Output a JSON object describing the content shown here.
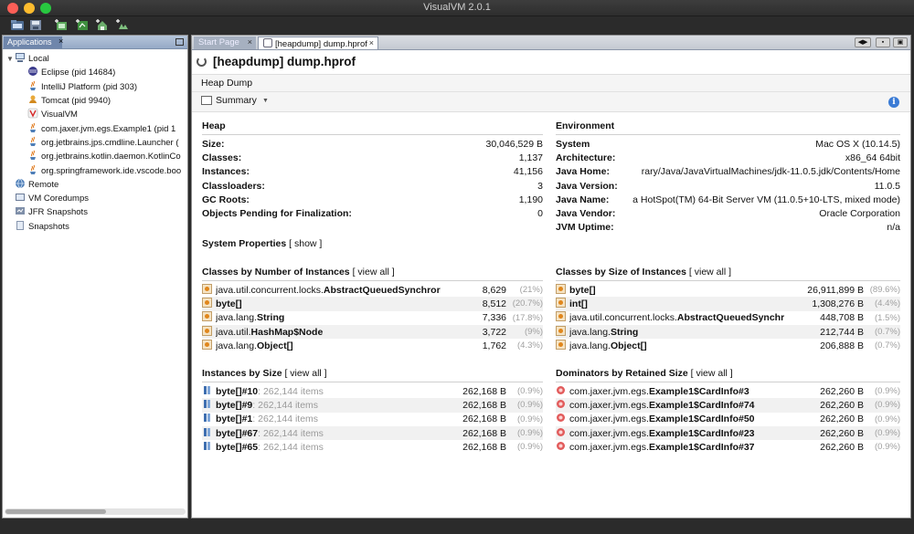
{
  "window": {
    "title": "VisualVM 2.0.1"
  },
  "toolbar": {
    "buttons": [
      "open-icon",
      "save-icon",
      "add-jmx-icon",
      "add-heap-icon",
      "add-host-icon",
      "add-snapshot-icon"
    ]
  },
  "left_panel": {
    "tab_label": "Applications",
    "tab_close": "×",
    "tree": [
      {
        "label": "Local",
        "level": 0,
        "icon": "computer-icon"
      },
      {
        "label": "Eclipse (pid 14684)",
        "level": 1,
        "icon": "eclipse-icon"
      },
      {
        "label": "IntelliJ Platform (pid 303)",
        "level": 1,
        "icon": "java-icon"
      },
      {
        "label": "Tomcat (pid 9940)",
        "level": 1,
        "icon": "tomcat-icon"
      },
      {
        "label": "VisualVM",
        "level": 1,
        "icon": "visualvm-icon"
      },
      {
        "label": "com.jaxer.jvm.egs.Example1 (pid 1",
        "level": 1,
        "icon": "java-icon"
      },
      {
        "label": "org.jetbrains.jps.cmdline.Launcher (",
        "level": 1,
        "icon": "java-icon"
      },
      {
        "label": "org.jetbrains.kotlin.daemon.KotlinCo",
        "level": 1,
        "icon": "java-icon"
      },
      {
        "label": "org.springframework.ide.vscode.boo",
        "level": 1,
        "icon": "java-icon"
      },
      {
        "label": "Remote",
        "level": 0,
        "icon": "remote-icon"
      },
      {
        "label": "VM Coredumps",
        "level": 0,
        "icon": "coredump-icon"
      },
      {
        "label": "JFR Snapshots",
        "level": 0,
        "icon": "jfr-icon"
      },
      {
        "label": "Snapshots",
        "level": 0,
        "icon": "snapshot-icon"
      }
    ]
  },
  "tabs": [
    {
      "label": "Start Page",
      "close": "×"
    },
    {
      "label": "[heapdump] dump.hprof",
      "close": "×"
    }
  ],
  "main": {
    "title": "[heapdump] dump.hprof",
    "subtitle": "Heap Dump",
    "view_selector": "Summary",
    "heap": {
      "title": "Heap",
      "rows": [
        {
          "key": "Size:",
          "value": "30,046,529 B"
        },
        {
          "key": "Classes:",
          "value": "1,137"
        },
        {
          "key": "Instances:",
          "value": "41,156"
        },
        {
          "key": "Classloaders:",
          "value": "3"
        },
        {
          "key": "GC Roots:",
          "value": "1,190"
        },
        {
          "key": "Objects Pending for Finalization:",
          "value": "0"
        }
      ]
    },
    "environment": {
      "title": "Environment",
      "rows": [
        {
          "key": "System",
          "value": "Mac OS X (10.14.5)"
        },
        {
          "key": "Architecture:",
          "value": "x86_64 64bit"
        },
        {
          "key": "Java Home:",
          "value": "rary/Java/JavaVirtualMachines/jdk-11.0.5.jdk/Contents/Home"
        },
        {
          "key": "Java Version:",
          "value": "11.0.5"
        },
        {
          "key": "Java Name:",
          "value": "a HotSpot(TM) 64-Bit Server VM (11.0.5+10-LTS, mixed mode)"
        },
        {
          "key": "Java Vendor:",
          "value": "Oracle Corporation"
        },
        {
          "key": "JVM Uptime:",
          "value": "n/a"
        }
      ]
    },
    "system_properties": {
      "title": "System Properties",
      "link": "[ show ]"
    },
    "classes_by_instances": {
      "title": "Classes by Number of Instances",
      "link": "[ view all ]",
      "rows": [
        {
          "prefix": "java.util.concurrent.locks.",
          "bold": "AbstractQueuedSynchror",
          "value": "8,629",
          "pct": "(21%)"
        },
        {
          "prefix": "",
          "bold": "byte[]",
          "value": "8,512",
          "pct": "(20.7%)"
        },
        {
          "prefix": "java.lang.",
          "bold": "String",
          "value": "7,336",
          "pct": "(17.8%)"
        },
        {
          "prefix": "java.util.",
          "bold": "HashMap$Node",
          "value": "3,722",
          "pct": "(9%)"
        },
        {
          "prefix": "java.lang.",
          "bold": "Object[]",
          "value": "1,762",
          "pct": "(4.3%)"
        }
      ]
    },
    "classes_by_size": {
      "title": "Classes by Size of Instances",
      "link": "[ view all ]",
      "rows": [
        {
          "prefix": "",
          "bold": "byte[]",
          "value": "26,911,899 B",
          "pct": "(89.6%)"
        },
        {
          "prefix": "",
          "bold": "int[]",
          "value": "1,308,276 B",
          "pct": "(4.4%)"
        },
        {
          "prefix": "java.util.concurrent.locks.",
          "bold": "AbstractQueuedSynchr",
          "value": "448,708 B",
          "pct": "(1.5%)"
        },
        {
          "prefix": "java.lang.",
          "bold": "String",
          "value": "212,744 B",
          "pct": "(0.7%)"
        },
        {
          "prefix": "java.lang.",
          "bold": "Object[]",
          "value": "206,888 B",
          "pct": "(0.7%)"
        }
      ]
    },
    "instances_by_size": {
      "title": "Instances by Size",
      "link": "[ view all ]",
      "rows": [
        {
          "bold": "byte[]#10",
          "items": ": 262,144 items",
          "value": "262,168 B",
          "pct": "(0.9%)"
        },
        {
          "bold": "byte[]#9",
          "items": ": 262,144 items",
          "value": "262,168 B",
          "pct": "(0.9%)"
        },
        {
          "bold": "byte[]#1",
          "items": ": 262,144 items",
          "value": "262,168 B",
          "pct": "(0.9%)"
        },
        {
          "bold": "byte[]#67",
          "items": ": 262,144 items",
          "value": "262,168 B",
          "pct": "(0.9%)"
        },
        {
          "bold": "byte[]#65",
          "items": ": 262,144 items",
          "value": "262,168 B",
          "pct": "(0.9%)"
        }
      ]
    },
    "dominators": {
      "title": "Dominators by Retained Size",
      "link": "[ view all ]",
      "rows": [
        {
          "prefix": "com.jaxer.jvm.egs.",
          "bold": "Example1$CardInfo#3",
          "value": "262,260 B",
          "pct": "(0.9%)"
        },
        {
          "prefix": "com.jaxer.jvm.egs.",
          "bold": "Example1$CardInfo#74",
          "value": "262,260 B",
          "pct": "(0.9%)"
        },
        {
          "prefix": "com.jaxer.jvm.egs.",
          "bold": "Example1$CardInfo#50",
          "value": "262,260 B",
          "pct": "(0.9%)"
        },
        {
          "prefix": "com.jaxer.jvm.egs.",
          "bold": "Example1$CardInfo#23",
          "value": "262,260 B",
          "pct": "(0.9%)"
        },
        {
          "prefix": "com.jaxer.jvm.egs.",
          "bold": "Example1$CardInfo#37",
          "value": "262,260 B",
          "pct": "(0.9%)"
        }
      ]
    }
  }
}
